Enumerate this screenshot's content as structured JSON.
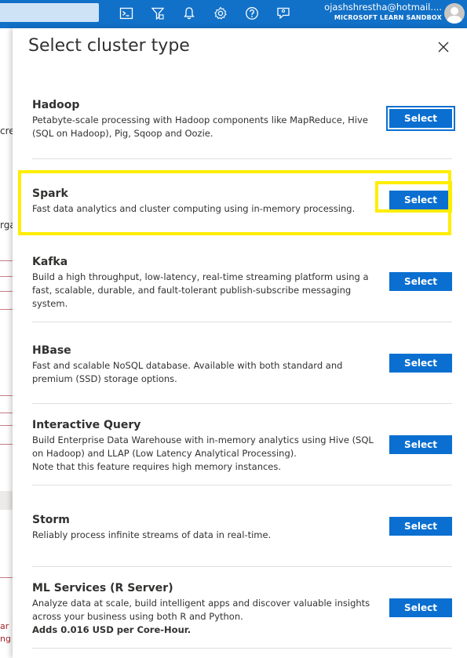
{
  "topbar": {
    "icons": [
      "cloud-shell-icon",
      "directory-filter-icon",
      "notifications-icon",
      "settings-icon",
      "help-icon",
      "feedback-icon"
    ],
    "account_email": "ojashshrestha@hotmail....",
    "account_directory": "MICROSOFT LEARN SANDBOX"
  },
  "background": {
    "fragments": [
      "cre",
      "rga",
      "ar",
      "ng s"
    ]
  },
  "panel": {
    "title": "Select cluster type",
    "close_label": "Close",
    "items": [
      {
        "name": "Hadoop",
        "description": "Petabyte-scale processing with Hadoop components like MapReduce, Hive (SQL on Hadoop), Pig, Sqoop and Oozie.",
        "button": "Select"
      },
      {
        "name": "Spark",
        "description": "Fast data analytics and cluster computing using in-memory processing.",
        "button": "Select"
      },
      {
        "name": "Kafka",
        "description": "Build a high throughput, low-latency, real-time streaming platform using a fast, scalable, durable, and fault-tolerant publish-subscribe messaging system.",
        "button": "Select"
      },
      {
        "name": "HBase",
        "description": "Fast and scalable NoSQL database. Available with both standard and premium (SSD) storage options.",
        "button": "Select"
      },
      {
        "name": "Interactive Query",
        "description": "Build Enterprise Data Warehouse with in-memory analytics using Hive (SQL on Hadoop) and LLAP (Low Latency Analytical Processing).",
        "note": "Note that this feature requires high memory instances.",
        "button": "Select"
      },
      {
        "name": "Storm",
        "description": "Reliably process infinite streams of data in real-time.",
        "button": "Select"
      },
      {
        "name": "ML Services (R Server)",
        "description": "Analyze data at scale, build intelligent apps and discover valuable insights across your business using both R and Python.",
        "price_note": "Adds 0.016 USD per Core-Hour.",
        "button": "Select"
      }
    ]
  },
  "colors": {
    "topbar": "#1170c7",
    "button": "#0a6fd0",
    "highlight": "#ffed00"
  }
}
